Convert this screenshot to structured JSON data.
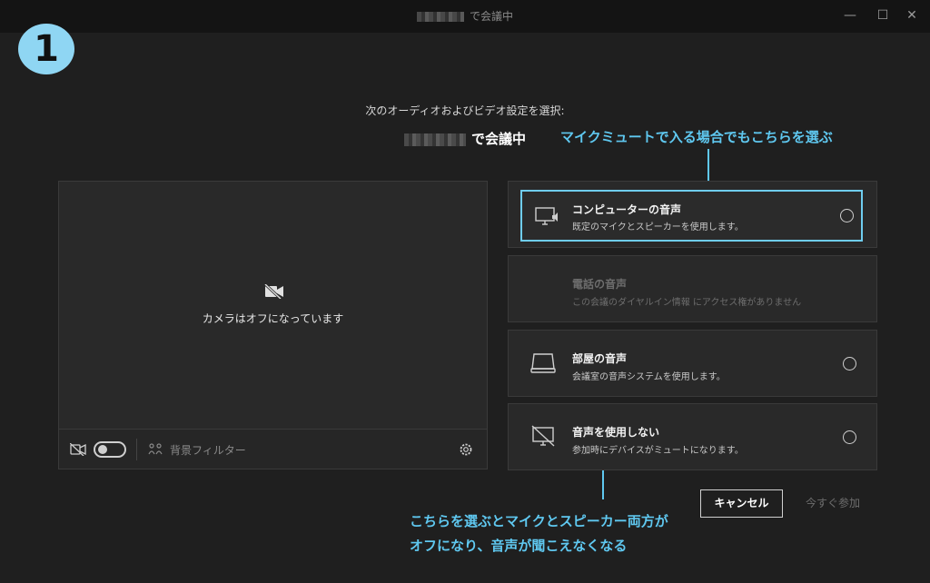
{
  "window": {
    "title_suffix": "で会議中",
    "minimize": "—",
    "maximize": "☐",
    "close": "✕"
  },
  "badge": "1",
  "prompt": "次のオーディオおよびビデオ設定を選択:",
  "meeting_suffix": "で会議中",
  "annotations": {
    "top": "マイクミュートで入る場合でもこちらを選ぶ",
    "bottom_line1": "こちらを選ぶとマイクとスピーカー両方が",
    "bottom_line2": "オフになり、音声が聞こえなくなる"
  },
  "video": {
    "camera_off_text": "カメラはオフになっています",
    "bg_filter_label": "背景フィルター"
  },
  "options": [
    {
      "title": "コンピューターの音声",
      "desc": "既定のマイクとスピーカーを使用します。",
      "selected": true,
      "icon": "computer-audio-icon"
    },
    {
      "title": "電話の音声",
      "desc": "この会議のダイヤルイン情報 にアクセス権がありません",
      "disabled": true,
      "icon": "phone-audio-icon"
    },
    {
      "title": "部屋の音声",
      "desc": "会議室の音声システムを使用します。",
      "icon": "room-audio-icon"
    },
    {
      "title": "音声を使用しない",
      "desc": "参加時にデバイスがミュートになります。",
      "icon": "no-audio-icon"
    }
  ],
  "buttons": {
    "cancel": "キャンセル",
    "join_now": "今すぐ参加"
  },
  "colors": {
    "accent": "#5fc8f0",
    "badge": "#8fd6f3",
    "background": "#1f1f1f",
    "panel": "#292929"
  }
}
